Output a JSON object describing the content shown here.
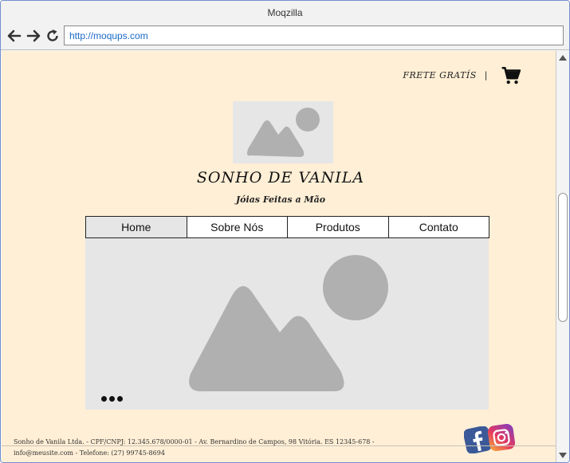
{
  "browser": {
    "title": "Moqzilla",
    "url": "http://moqups.com"
  },
  "header": {
    "shipping_text": "FRETE GRATÍS",
    "separator": "|"
  },
  "brand": {
    "title": "SONHO DE VANILA",
    "subtitle": "Jóias Feitas a Mão"
  },
  "menu": {
    "items": [
      {
        "label": "Home"
      },
      {
        "label": "Sobre Nós"
      },
      {
        "label": "Produtos"
      },
      {
        "label": "Contato"
      }
    ]
  },
  "footer": {
    "line1": "Sonho de Vanila Ltda. - CPF/CNPJ: 12.345.678/0000-01 - Av. Bernardino de Campos, 98 Vitória. ES 12345-678 -",
    "line2": "info@meusite.com -  Telefone: (27) 99745-8694"
  },
  "icons": {
    "back": "arrow-left-icon",
    "forward": "arrow-right-icon",
    "reload": "reload-icon",
    "cart": "shopping-cart-icon",
    "facebook": "facebook-icon",
    "instagram": "instagram-icon"
  },
  "colors": {
    "page_background": "#ffefd6",
    "placeholder_background": "#e6e6e6",
    "placeholder_shape": "#b0b0b0",
    "url_text": "#1a6ac6",
    "facebook_blue": "#3b5998"
  }
}
